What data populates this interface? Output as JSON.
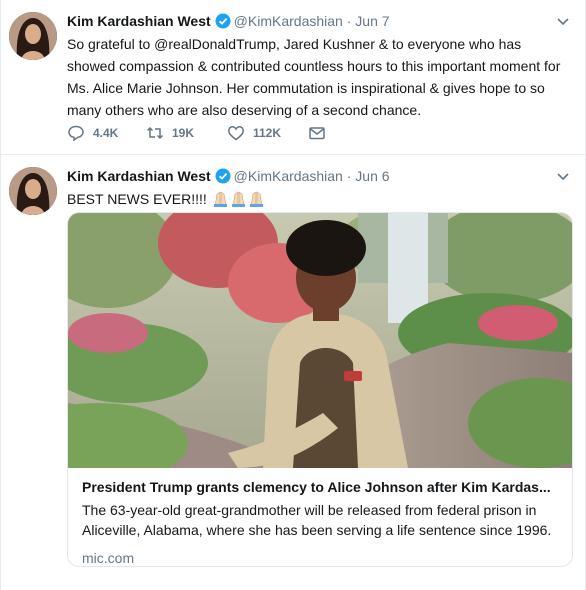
{
  "colors": {
    "accent": "#1da1f2",
    "secondary_text": "#657786",
    "border": "#e6ecf0"
  },
  "tweets": [
    {
      "name": "Kim Kardashian West",
      "handle": "@KimKardashian",
      "separator": "·",
      "time": "Jun 7",
      "text": "So grateful to @realDonaldTrump, Jared Kushner & to everyone who has showed compassion & contributed countless hours to this important moment for Ms. Alice Marie Johnson. Her commutation is inspirational & gives hope to so many others who are also deserving of a second chance.",
      "actions": {
        "replies": "4.4K",
        "retweets": "19K",
        "likes": "112K"
      },
      "icons": {
        "reply": "reply-icon",
        "retweet": "retweet-icon",
        "like": "heart-icon",
        "dm": "direct-message-icon"
      }
    },
    {
      "name": "Kim Kardashian West",
      "handle": "@KimKardashian",
      "separator": "·",
      "time": "Jun 6",
      "text": "BEST NEWS EVER!!!!",
      "card": {
        "title": "President Trump grants clemency to Alice Johnson after Kim Kardas...",
        "description": "The 63-year-old great-grandmother will be released from federal prison in Aliceville, Alabama, where she has been serving a life sentence since 1996.",
        "domain": "mic.com"
      }
    }
  ]
}
